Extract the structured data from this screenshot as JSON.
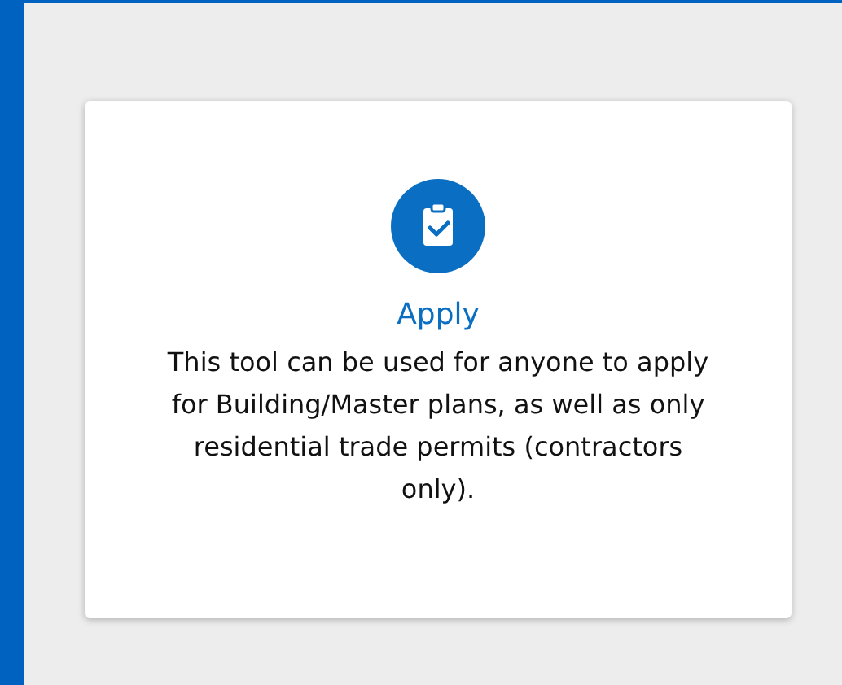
{
  "card": {
    "title": "Apply",
    "description": "This tool can be used for anyone to apply for Building/Master plans, as well as only residential trade permits (contractors only)."
  }
}
